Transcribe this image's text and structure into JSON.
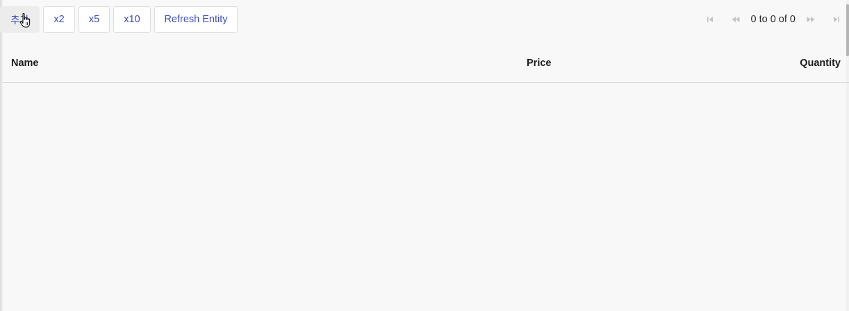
{
  "toolbar": {
    "add_label": "추가",
    "x2_label": "x2",
    "x5_label": "x5",
    "x10_label": "x10",
    "refresh_label": "Refresh Entity"
  },
  "pager": {
    "summary": "0 to 0 of 0",
    "first_icon": "first-page-icon",
    "prev_icon": "previous-page-icon",
    "next_icon": "next-page-icon",
    "last_icon": "last-page-icon"
  },
  "grid": {
    "columns": [
      "Name",
      "Price",
      "Quantity"
    ],
    "rows": []
  },
  "colors": {
    "accent": "#3d4dbf",
    "background": "#f8f8f8",
    "disabled_icon": "#c4c4c4"
  }
}
